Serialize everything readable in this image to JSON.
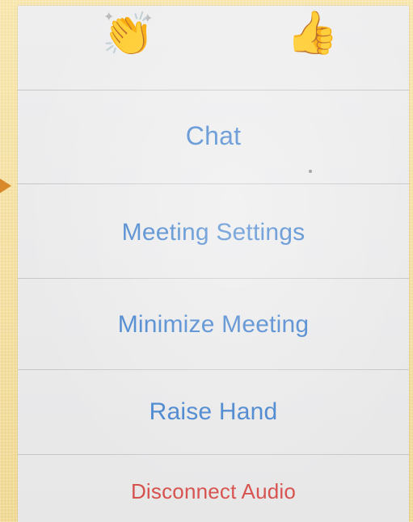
{
  "reactions": {
    "clap_icon": "clapping-hands-icon",
    "clap_glyph": "👏",
    "thumbs_icon": "thumbs-up-icon",
    "thumbs_glyph": "👍"
  },
  "menu": {
    "items": [
      {
        "label": "Chat"
      },
      {
        "label": "Meeting Settings"
      },
      {
        "label": "Minimize Meeting"
      },
      {
        "label": "Raise Hand"
      },
      {
        "label": "Disconnect Audio"
      }
    ]
  },
  "colors": {
    "action_blue": "#3f7fcc",
    "destructive_red": "#d6504c",
    "slide_background": "#f2dc9a",
    "arrow_orange": "#d9882a"
  }
}
